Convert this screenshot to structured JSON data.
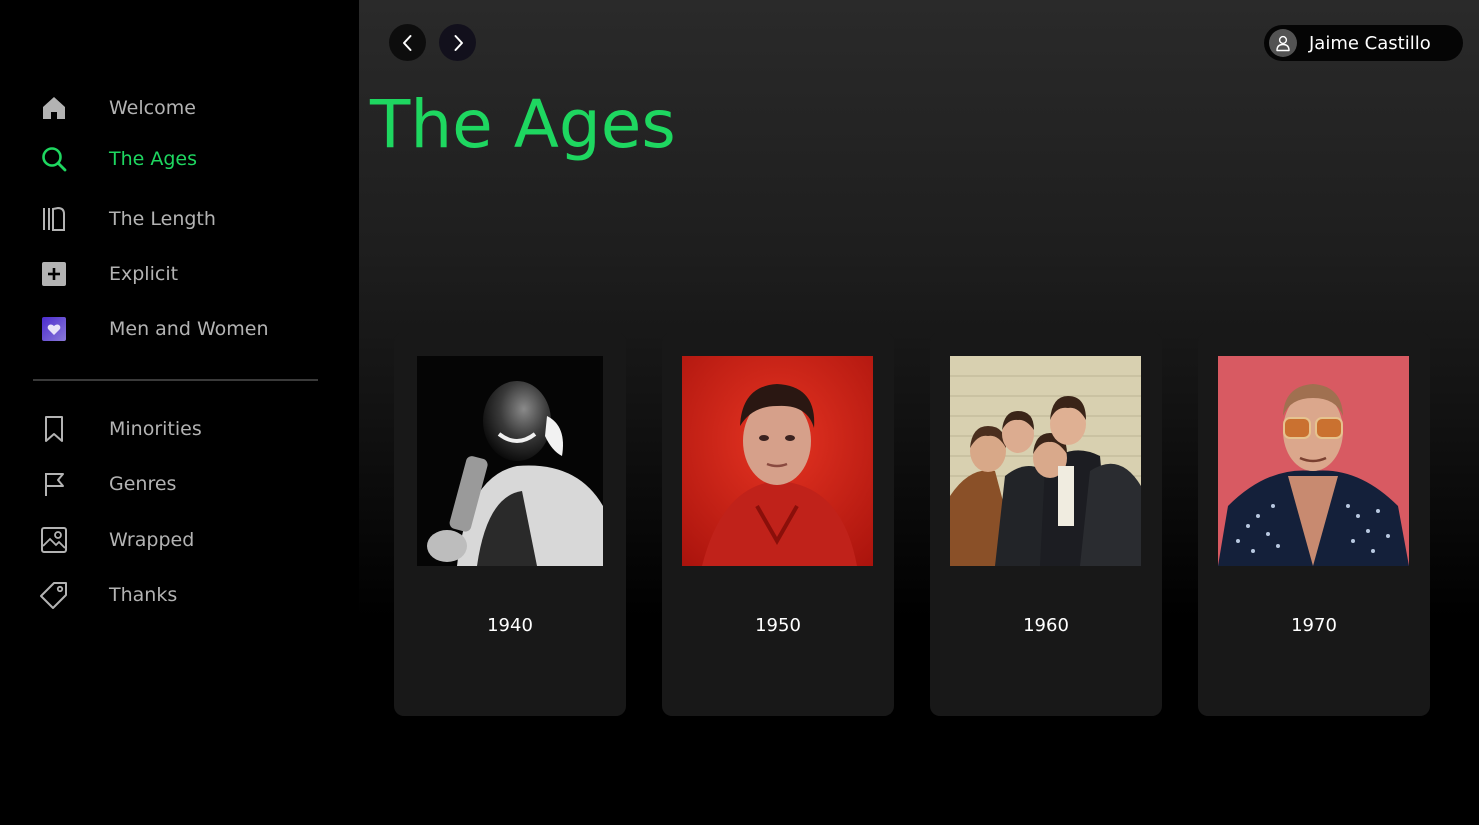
{
  "sidebar": {
    "items": [
      {
        "label": "Welcome",
        "icon": "home-icon"
      },
      {
        "label": "The Ages",
        "icon": "search-icon",
        "active": true
      },
      {
        "label": "The Length",
        "icon": "library-icon"
      },
      {
        "label": "Explicit",
        "icon": "plus-square-icon"
      },
      {
        "label": "Men and Women",
        "icon": "heart-square-icon"
      },
      {
        "label": "Minorities",
        "icon": "bookmark-icon"
      },
      {
        "label": "Genres",
        "icon": "flag-icon"
      },
      {
        "label": "Wrapped",
        "icon": "image-icon"
      },
      {
        "label": "Thanks",
        "icon": "tag-icon"
      }
    ]
  },
  "header": {
    "back_icon": "chevron-left-icon",
    "forward_icon": "chevron-right-icon",
    "user_name": "Jaime Castillo",
    "user_icon": "user-icon"
  },
  "main": {
    "title": "The Ages",
    "cards": [
      {
        "year": "1940",
        "image": "black-and-white-trumpet-player-photo"
      },
      {
        "year": "1950",
        "image": "singer-portrait-red-background-photo"
      },
      {
        "year": "1960",
        "image": "four-member-band-group-photo"
      },
      {
        "year": "1970",
        "image": "singer-sequined-suit-pink-background-photo"
      }
    ]
  },
  "colors": {
    "accent": "#1ed760",
    "sidebar_text": "#b3b3b3",
    "card_bg": "#181818",
    "background": "#000000"
  }
}
